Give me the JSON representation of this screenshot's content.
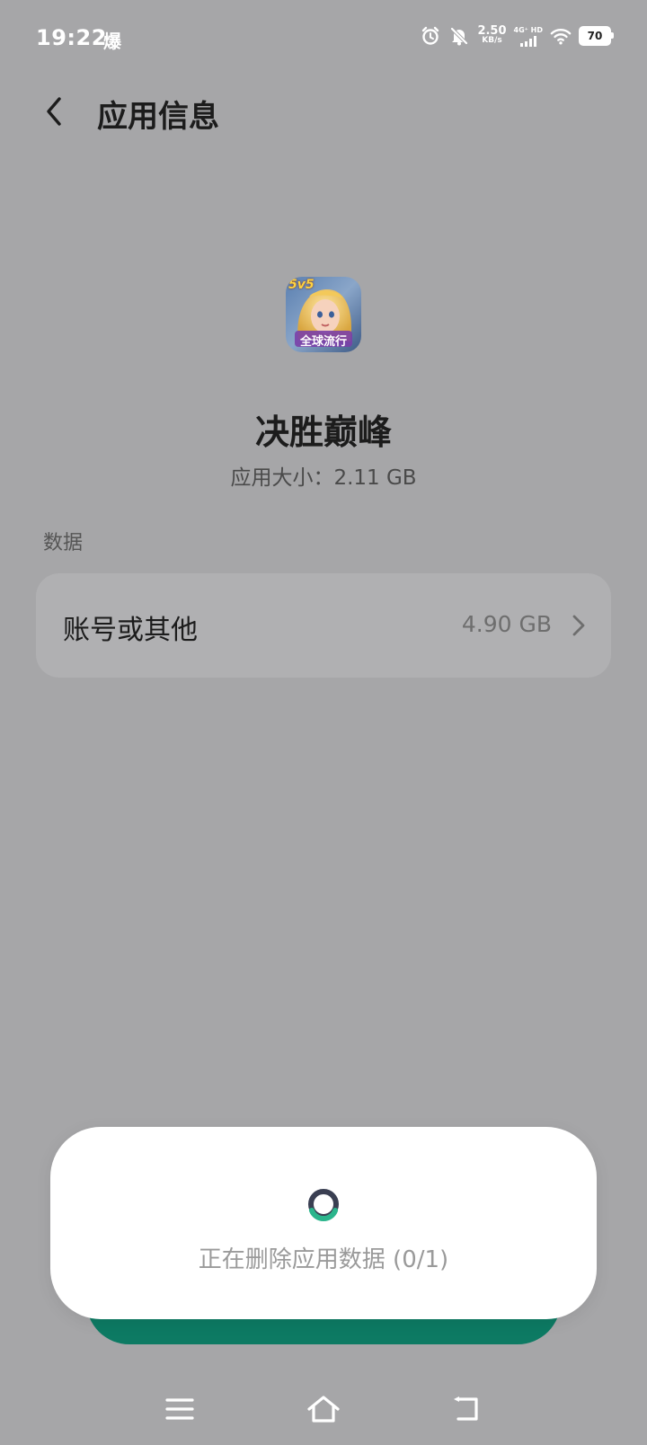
{
  "status_bar": {
    "time": "19:22",
    "burst_char": "爆",
    "speed_value": "2.50",
    "speed_unit": "KB/s",
    "network_label": "4G⁺ HD",
    "battery": "70",
    "icons": [
      "alarm-icon",
      "mute-bell-icon",
      "signal-icon",
      "wifi-icon",
      "battery-icon"
    ]
  },
  "header": {
    "title": "应用信息",
    "back_icon": "chevron-left-icon"
  },
  "app": {
    "name": "决胜巅峰",
    "size": "应用大小：2.11 GB",
    "icon_badge": "5v5",
    "icon_banner": "全球流行"
  },
  "data_section": {
    "label": "数据",
    "row": {
      "label": "账号或其他",
      "value": "4.90 GB"
    }
  },
  "dialog": {
    "message": "正在删除应用数据 (0/1)"
  },
  "nav": {
    "icons": [
      "menu-icon",
      "home-icon",
      "back-icon"
    ]
  },
  "colors": {
    "background": "#a6a6a8",
    "accent_green": "#0d7a63",
    "spinner_dark": "#3a3f52",
    "spinner_green": "#2bb58c"
  }
}
